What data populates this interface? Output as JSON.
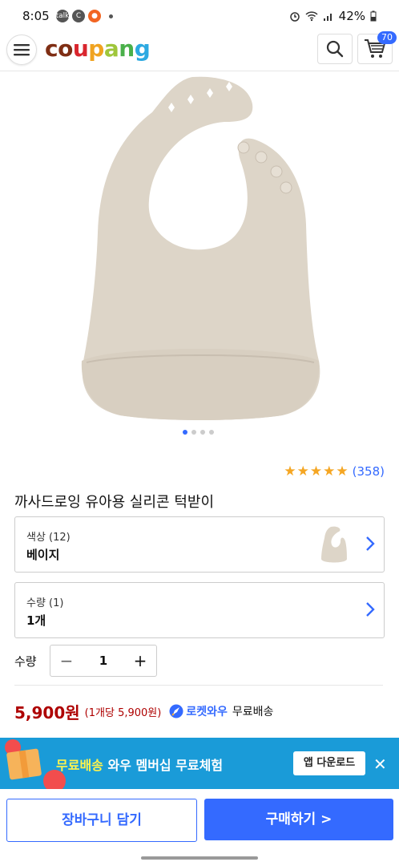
{
  "status": {
    "time": "8:05",
    "battery": "42%",
    "notif_icons": [
      "talk",
      "C",
      "●"
    ]
  },
  "header": {
    "logo_letters": [
      {
        "ch": "c",
        "color": "#7f2e14"
      },
      {
        "ch": "o",
        "color": "#7f2e14"
      },
      {
        "ch": "u",
        "color": "#d9262e"
      },
      {
        "ch": "p",
        "color": "#f0a320"
      },
      {
        "ch": "a",
        "color": "#9fc63b"
      },
      {
        "ch": "n",
        "color": "#4ab04a"
      },
      {
        "ch": "g",
        "color": "#2da9e1"
      }
    ],
    "cart_count": "70"
  },
  "product": {
    "rating_count": "(358)",
    "rating_stars": 5,
    "title": "까사드로잉 유아용 실리콘 턱받이",
    "image_page_count": 4,
    "image_page_active": 1
  },
  "options": {
    "color_label": "색상 (12)",
    "color_value": "베이지",
    "qty_option_label": "수량 (1)",
    "qty_option_value": "1개"
  },
  "quantity": {
    "label": "수량",
    "value": "1",
    "minus": "−",
    "plus": "+"
  },
  "price": {
    "price": "5,900원",
    "unit_price": "(1개당 5,900원)",
    "rocket_label": "로켓와우",
    "shipping": "무료배송"
  },
  "promo": {
    "highlight": "무료배송",
    "text": " 와우 멤버십 무료체험",
    "button": "앱 다운로드",
    "close": "✕"
  },
  "actions": {
    "add_to_cart": "장바구니 담기",
    "buy_now": "구매하기 >"
  },
  "colors": {
    "accent": "#346aff",
    "price": "#ae0000",
    "promo_bg": "#1a9bd8",
    "star": "#f5a623",
    "bib": "#ddd5c8"
  }
}
